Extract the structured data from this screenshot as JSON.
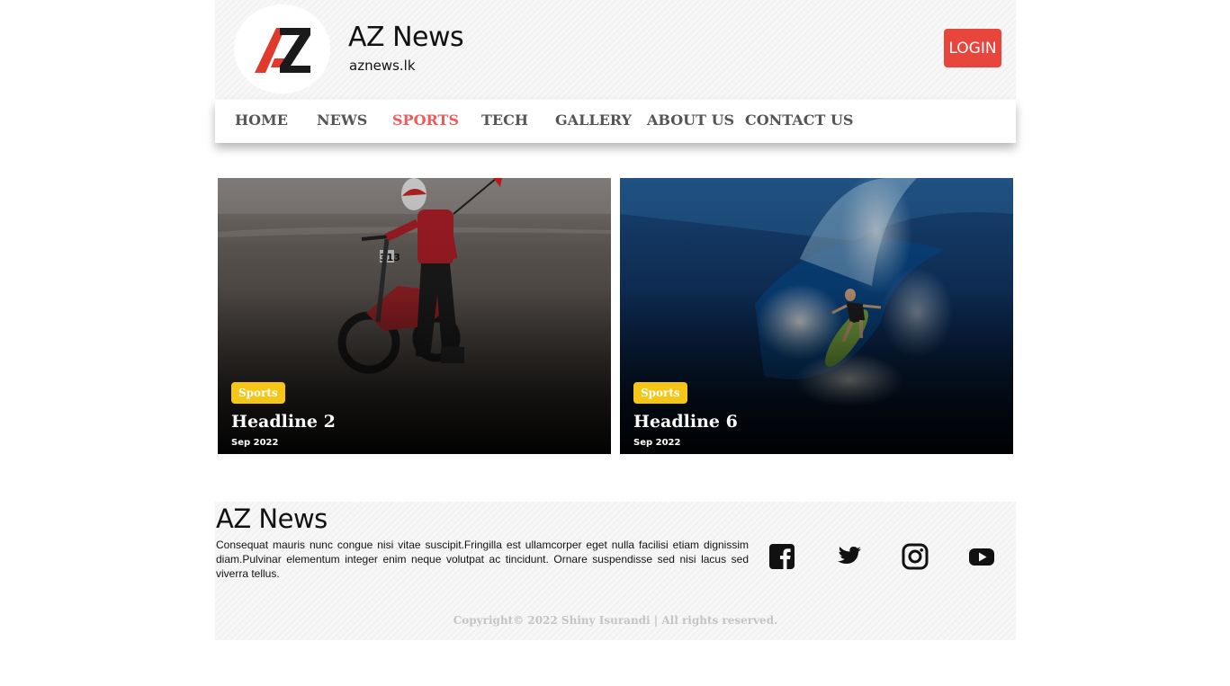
{
  "header": {
    "brand_title": "AZ News",
    "brand_subtitle": "aznews.lk",
    "login_label": "LOGIN",
    "accent_color": "#e8453c"
  },
  "nav": {
    "items": [
      {
        "label": "HOME"
      },
      {
        "label": "NEWS"
      },
      {
        "label": "SPORTS",
        "active": true
      },
      {
        "label": "TECH"
      },
      {
        "label": "GALLERY"
      },
      {
        "label": "ABOUT US"
      },
      {
        "label": "CONTACT US"
      }
    ],
    "active_color": "#f25a5a"
  },
  "cards": [
    {
      "category": "Sports",
      "headline": "Headline 2",
      "date": "Sep 2022",
      "image": "motocross-rider-on-beach"
    },
    {
      "category": "Sports",
      "headline": "Headline 6",
      "date": "Sep 2022",
      "image": "surfer-in-wave"
    }
  ],
  "footer": {
    "title": "AZ News",
    "text": "Consequat mauris nunc congue nisi vitae suscipit.Fringilla est ullamcorper eget nulla facilisi etiam dignissim diam.Pulvinar elementum integer enim neque volutpat ac tincidunt. Ornare suspendisse sed nisi lacus sed viverra tellus.",
    "social_icons": [
      "facebook-icon",
      "twitter-icon",
      "instagram-icon",
      "youtube-icon"
    ],
    "copyright": "Copyright© 2022 Shiny Isurandi | All rights reserved."
  }
}
